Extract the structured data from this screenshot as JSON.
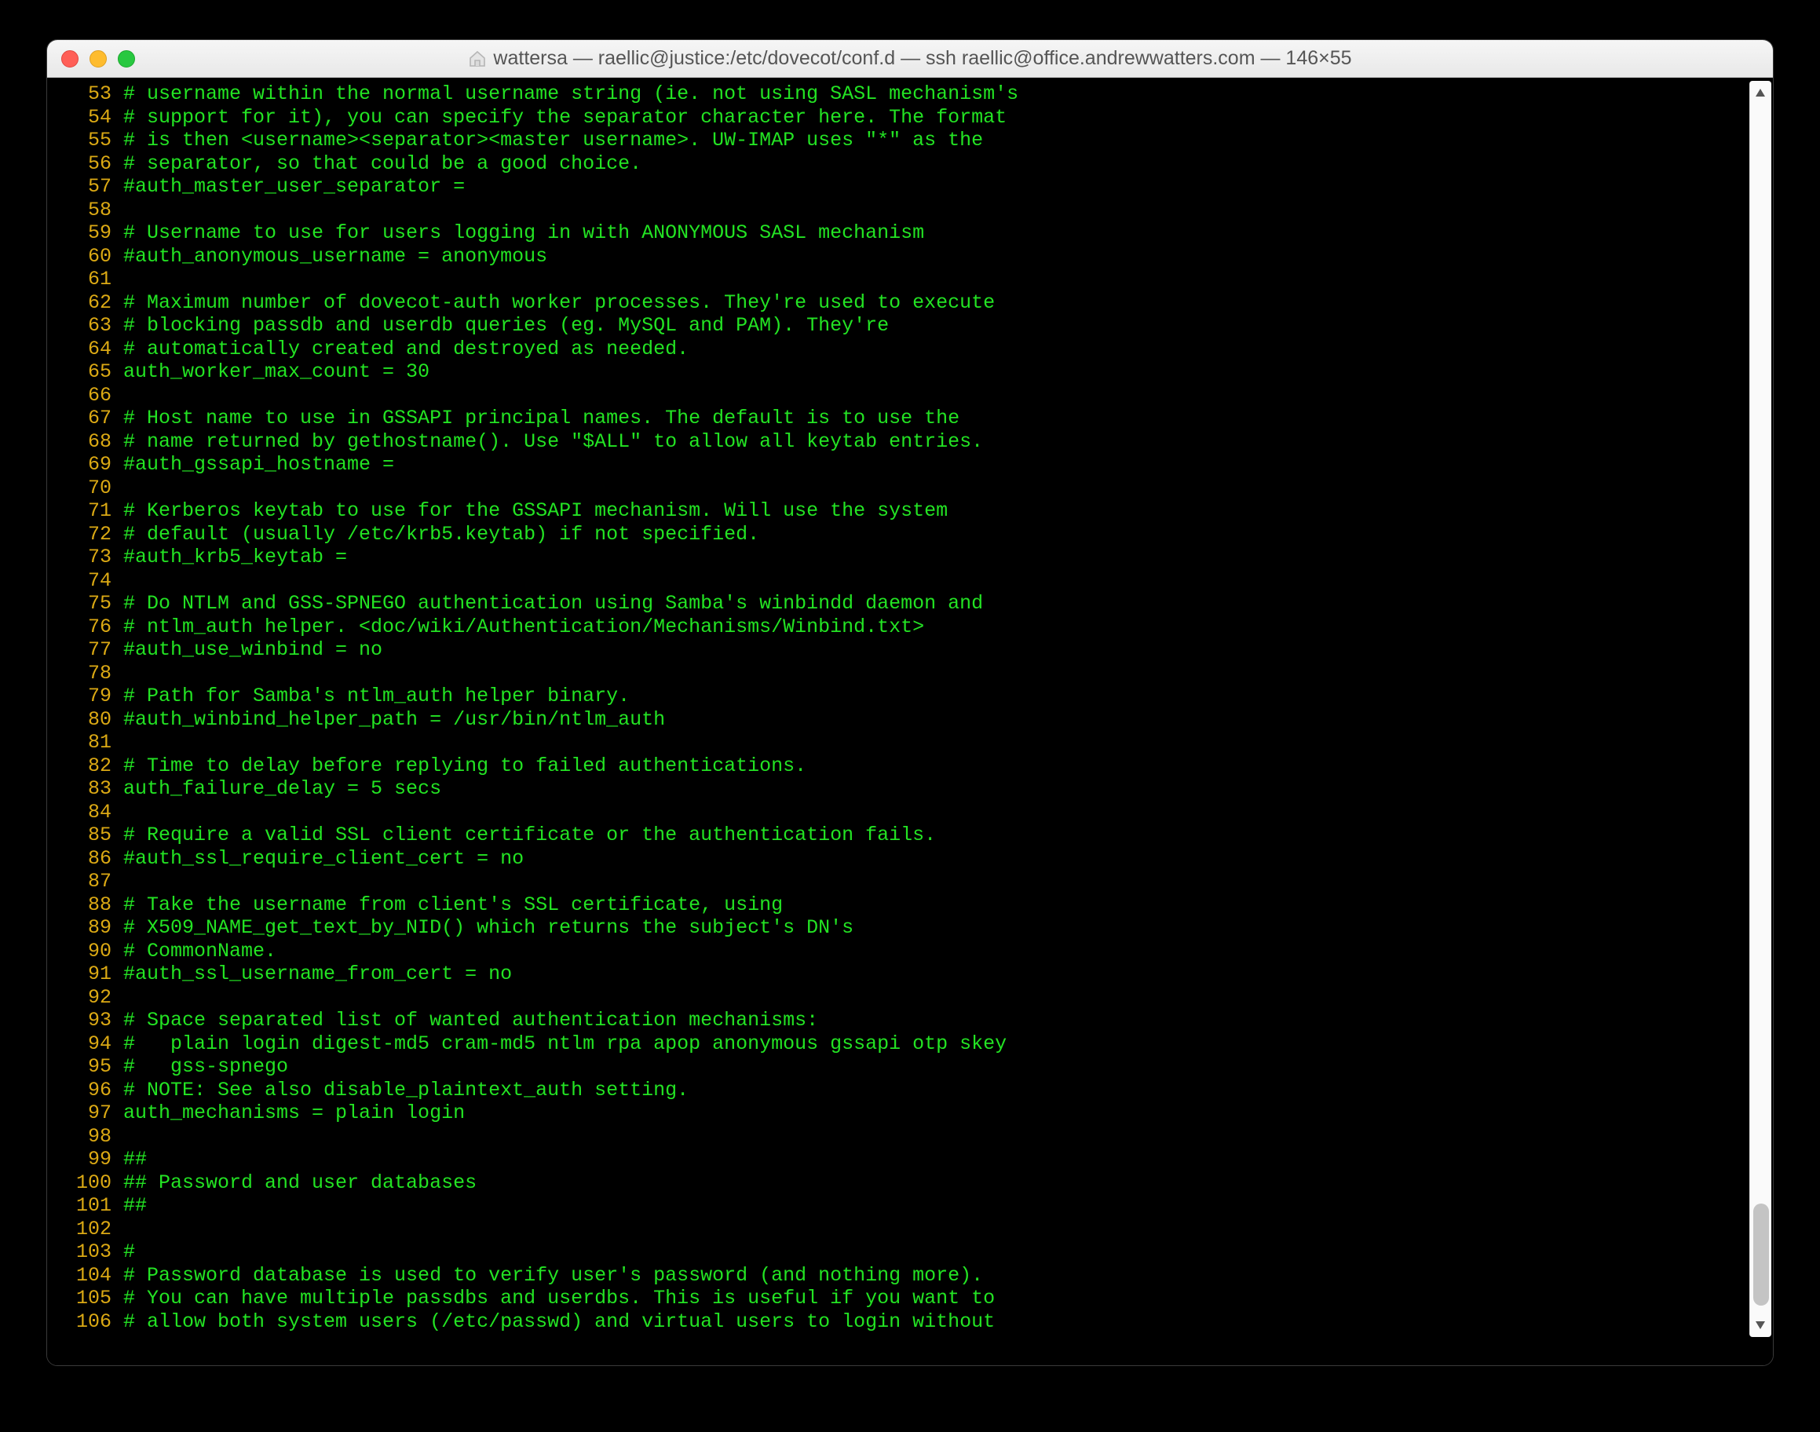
{
  "window": {
    "title": "wattersa — raellic@justice:/etc/dovecot/conf.d — ssh raellic@office.andrewwatters.com — 146×55"
  },
  "lines": [
    {
      "n": 53,
      "t": "# username within the normal username string (ie. not using SASL mechanism's"
    },
    {
      "n": 54,
      "t": "# support for it), you can specify the separator character here. The format"
    },
    {
      "n": 55,
      "t": "# is then <username><separator><master username>. UW-IMAP uses \"*\" as the"
    },
    {
      "n": 56,
      "t": "# separator, so that could be a good choice."
    },
    {
      "n": 57,
      "t": "#auth_master_user_separator ="
    },
    {
      "n": 58,
      "t": ""
    },
    {
      "n": 59,
      "t": "# Username to use for users logging in with ANONYMOUS SASL mechanism"
    },
    {
      "n": 60,
      "t": "#auth_anonymous_username = anonymous"
    },
    {
      "n": 61,
      "t": ""
    },
    {
      "n": 62,
      "t": "# Maximum number of dovecot-auth worker processes. They're used to execute"
    },
    {
      "n": 63,
      "t": "# blocking passdb and userdb queries (eg. MySQL and PAM). They're"
    },
    {
      "n": 64,
      "t": "# automatically created and destroyed as needed."
    },
    {
      "n": 65,
      "t": "auth_worker_max_count = 30"
    },
    {
      "n": 66,
      "t": ""
    },
    {
      "n": 67,
      "t": "# Host name to use in GSSAPI principal names. The default is to use the"
    },
    {
      "n": 68,
      "t": "# name returned by gethostname(). Use \"$ALL\" to allow all keytab entries."
    },
    {
      "n": 69,
      "t": "#auth_gssapi_hostname ="
    },
    {
      "n": 70,
      "t": ""
    },
    {
      "n": 71,
      "t": "# Kerberos keytab to use for the GSSAPI mechanism. Will use the system"
    },
    {
      "n": 72,
      "t": "# default (usually /etc/krb5.keytab) if not specified."
    },
    {
      "n": 73,
      "t": "#auth_krb5_keytab ="
    },
    {
      "n": 74,
      "t": ""
    },
    {
      "n": 75,
      "t": "# Do NTLM and GSS-SPNEGO authentication using Samba's winbindd daemon and"
    },
    {
      "n": 76,
      "t": "# ntlm_auth helper. <doc/wiki/Authentication/Mechanisms/Winbind.txt>"
    },
    {
      "n": 77,
      "t": "#auth_use_winbind = no"
    },
    {
      "n": 78,
      "t": ""
    },
    {
      "n": 79,
      "t": "# Path for Samba's ntlm_auth helper binary."
    },
    {
      "n": 80,
      "t": "#auth_winbind_helper_path = /usr/bin/ntlm_auth"
    },
    {
      "n": 81,
      "t": ""
    },
    {
      "n": 82,
      "t": "# Time to delay before replying to failed authentications."
    },
    {
      "n": 83,
      "t": "auth_failure_delay = 5 secs"
    },
    {
      "n": 84,
      "t": ""
    },
    {
      "n": 85,
      "t": "# Require a valid SSL client certificate or the authentication fails."
    },
    {
      "n": 86,
      "t": "#auth_ssl_require_client_cert = no"
    },
    {
      "n": 87,
      "t": ""
    },
    {
      "n": 88,
      "t": "# Take the username from client's SSL certificate, using"
    },
    {
      "n": 89,
      "t": "# X509_NAME_get_text_by_NID() which returns the subject's DN's"
    },
    {
      "n": 90,
      "t": "# CommonName."
    },
    {
      "n": 91,
      "t": "#auth_ssl_username_from_cert = no"
    },
    {
      "n": 92,
      "t": ""
    },
    {
      "n": 93,
      "t": "# Space separated list of wanted authentication mechanisms:"
    },
    {
      "n": 94,
      "t": "#   plain login digest-md5 cram-md5 ntlm rpa apop anonymous gssapi otp skey"
    },
    {
      "n": 95,
      "t": "#   gss-spnego"
    },
    {
      "n": 96,
      "t": "# NOTE: See also disable_plaintext_auth setting."
    },
    {
      "n": 97,
      "t": "auth_mechanisms = plain login"
    },
    {
      "n": 98,
      "t": ""
    },
    {
      "n": 99,
      "t": "##"
    },
    {
      "n": 100,
      "t": "## Password and user databases"
    },
    {
      "n": 101,
      "t": "##"
    },
    {
      "n": 102,
      "t": ""
    },
    {
      "n": 103,
      "t": "#"
    },
    {
      "n": 104,
      "t": "# Password database is used to verify user's password (and nothing more)."
    },
    {
      "n": 105,
      "t": "# You can have multiple passdbs and userdbs. This is useful if you want to"
    },
    {
      "n": 106,
      "t": "# allow both system users (/etc/passwd) and virtual users to login without"
    }
  ]
}
